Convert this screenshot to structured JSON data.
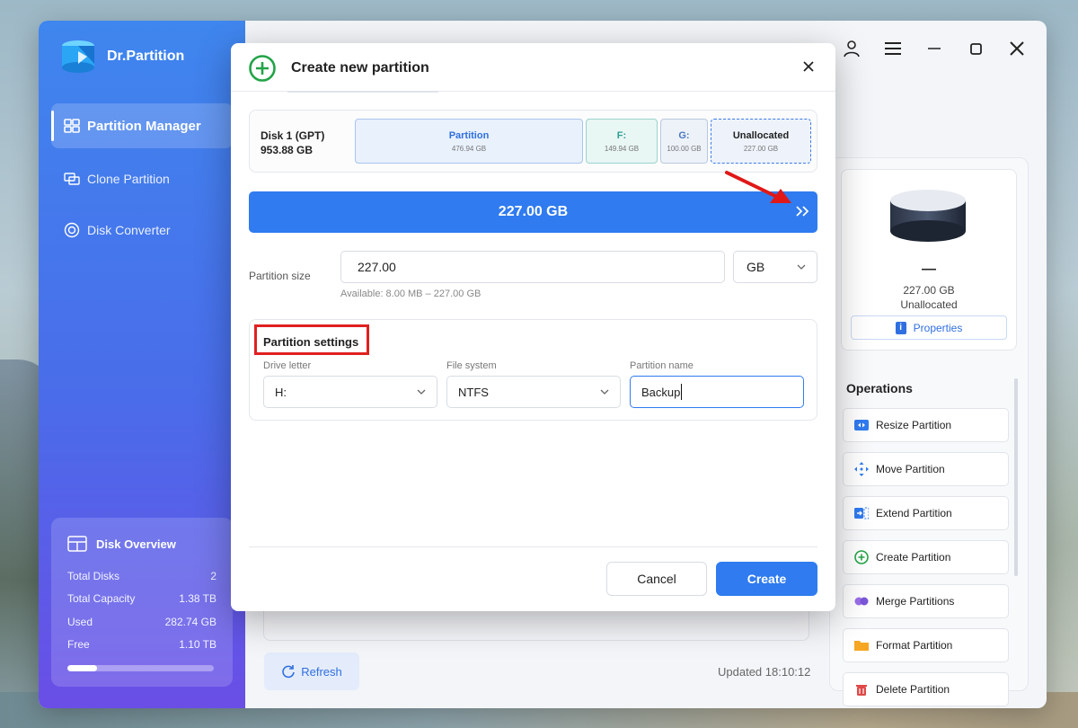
{
  "app": {
    "name": "Dr.Partition"
  },
  "sidebar": {
    "items": [
      {
        "label": "Partition Manager",
        "icon": "grid-icon",
        "active": true
      },
      {
        "label": "Clone Partition",
        "icon": "clone-icon",
        "active": false
      },
      {
        "label": "Disk Converter",
        "icon": "convert-icon",
        "active": false
      }
    ],
    "overview": {
      "title": "Disk Overview",
      "rows": [
        {
          "label": "Total Disks",
          "value": "2"
        },
        {
          "label": "Total Capacity",
          "value": "1.38 TB"
        },
        {
          "label": "Used",
          "value": "282.74 GB"
        },
        {
          "label": "Free",
          "value": "1.10 TB"
        }
      ],
      "used_fraction": 0.2
    }
  },
  "right_panel": {
    "disk": {
      "name": "—",
      "size": "227.00 GB",
      "type": "Unallocated",
      "properties_label": "Properties"
    },
    "operations_title": "Operations",
    "operations": [
      {
        "label": "Resize Partition",
        "icon": "resize-icon"
      },
      {
        "label": "Move Partition",
        "icon": "move-icon"
      },
      {
        "label": "Extend Partition",
        "icon": "extend-icon"
      },
      {
        "label": "Create Partition",
        "icon": "plus-circle-icon"
      },
      {
        "label": "Merge Partitions",
        "icon": "merge-icon"
      },
      {
        "label": "Format Partition",
        "icon": "folder-icon"
      },
      {
        "label": "Delete Partition",
        "icon": "trash-icon"
      }
    ]
  },
  "footer": {
    "refresh_label": "Refresh",
    "updated_text": "Updated 18:10:12"
  },
  "modal": {
    "title": "Create new partition",
    "disk": {
      "name": "Disk 1 (GPT)",
      "size": "953.88 GB",
      "segments": [
        {
          "label": "Partition",
          "size": "476.94 GB"
        },
        {
          "label": "F:",
          "size": "149.94 GB"
        },
        {
          "label": "G:",
          "size": "100.00 GB"
        },
        {
          "label": "Unallocated",
          "size": "227.00 GB"
        }
      ]
    },
    "size_bar_value": "227.00 GB",
    "partition_size": {
      "label": "Partition size",
      "value": "227.00",
      "unit": "GB",
      "available": "Available: 8.00 MB – 227.00 GB"
    },
    "settings": {
      "title": "Partition settings",
      "drive_letter_label": "Drive letter",
      "drive_letter_value": "H:",
      "file_system_label": "File system",
      "file_system_value": "NTFS",
      "partition_name_label": "Partition name",
      "partition_name_value": "Backup"
    },
    "cancel_label": "Cancel",
    "create_label": "Create"
  },
  "colors": {
    "accent": "#2f7bef",
    "highlight_red": "#e02020",
    "create_green": "#22a447"
  }
}
